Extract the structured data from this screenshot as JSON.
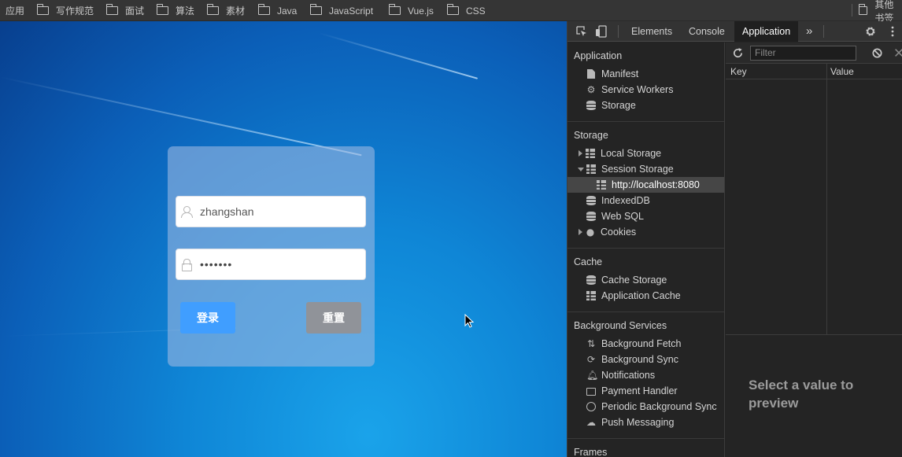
{
  "bookmarks": {
    "items": [
      "应用",
      "写作规范",
      "面试",
      "算法",
      "素材",
      "Java",
      "JavaScript",
      "Vue.js",
      "CSS"
    ],
    "overflow_label": "其他书签"
  },
  "login": {
    "username_value": "zhangshan",
    "password_value": "•••••••",
    "login_button": "登录",
    "reset_button": "重置"
  },
  "devtools": {
    "tabs": [
      "Elements",
      "Console",
      "Application"
    ],
    "active_tab": "Application",
    "more_tabs": "»",
    "sidebar": {
      "application": {
        "title": "Application",
        "items": [
          "Manifest",
          "Service Workers",
          "Storage"
        ]
      },
      "storage": {
        "title": "Storage",
        "items": [
          "Local Storage",
          "Session Storage",
          "http://localhost:8080",
          "IndexedDB",
          "Web SQL",
          "Cookies"
        ]
      },
      "cache": {
        "title": "Cache",
        "items": [
          "Cache Storage",
          "Application Cache"
        ]
      },
      "background_services": {
        "title": "Background Services",
        "items": [
          "Background Fetch",
          "Background Sync",
          "Notifications",
          "Payment Handler",
          "Periodic Background Sync",
          "Push Messaging"
        ]
      },
      "frames": {
        "title": "Frames"
      }
    },
    "filter_placeholder": "Filter",
    "table": {
      "key_header": "Key",
      "value_header": "Value"
    },
    "preview_text": "Select a value to preview"
  }
}
